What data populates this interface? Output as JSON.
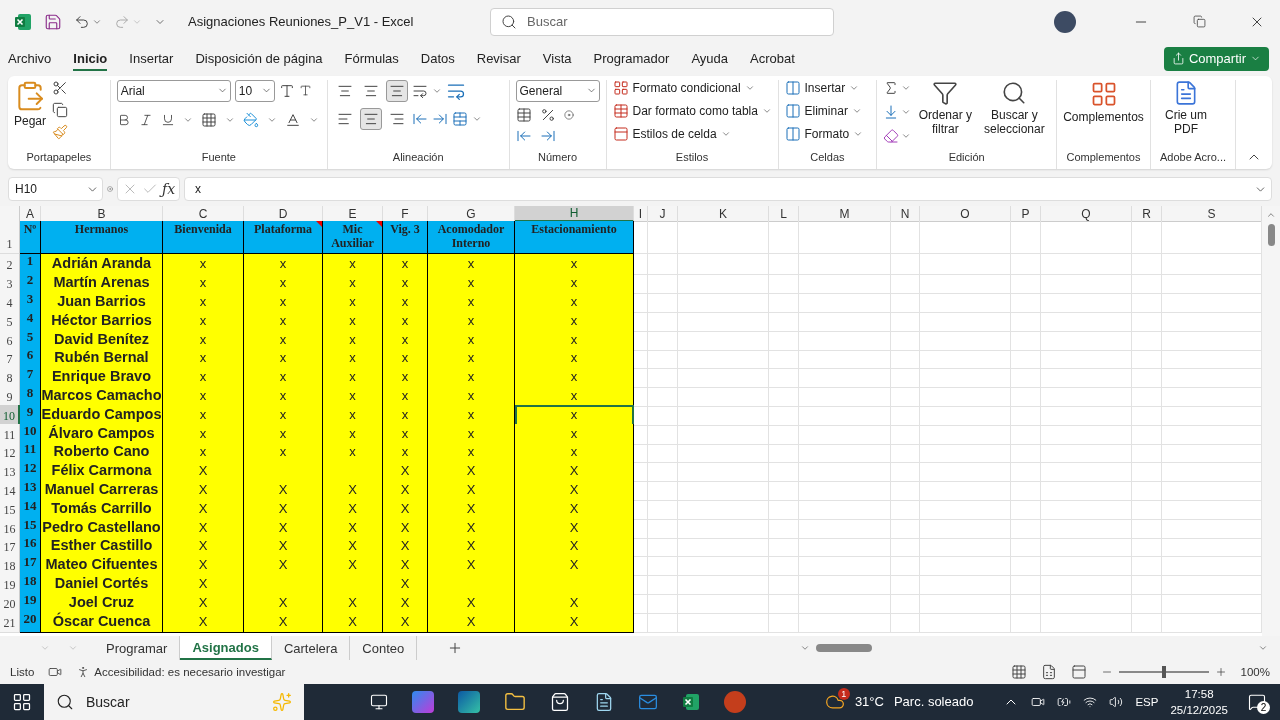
{
  "title_bar": {
    "title": "Asignaciones Reuniones_P_V1  -  Excel",
    "search": {
      "placeholder": "Buscar"
    }
  },
  "menu": {
    "tabs": [
      {
        "label": "Archivo",
        "selected": false
      },
      {
        "label": "Inicio",
        "selected": true
      },
      {
        "label": "Insertar",
        "selected": false
      },
      {
        "label": "Disposición de página",
        "selected": false
      },
      {
        "label": "Fórmulas",
        "selected": false
      },
      {
        "label": "Datos",
        "selected": false
      },
      {
        "label": "Revisar",
        "selected": false
      },
      {
        "label": "Vista",
        "selected": false
      },
      {
        "label": "Programador",
        "selected": false
      },
      {
        "label": "Ayuda",
        "selected": false
      },
      {
        "label": "Acrobat",
        "selected": false
      }
    ],
    "share": "Compartir"
  },
  "ribbon": {
    "clipboard": {
      "label": "Portapapeles",
      "paste": "Pegar"
    },
    "font": {
      "label": "Fuente",
      "font": "Arial",
      "size": "10"
    },
    "alignment": {
      "label": "Alineación",
      "vertical": [
        {
          "selected": false
        },
        {
          "selected": false
        },
        {
          "selected": true
        }
      ],
      "horizontal": [
        {
          "selected": false
        },
        {
          "selected": true
        },
        {
          "selected": false
        }
      ]
    },
    "number": {
      "label": "Número",
      "format": "General"
    },
    "styles": {
      "label": "Estilos",
      "items": [
        "Formato condicional",
        "Dar formato como tabla",
        "Estilos de celda"
      ]
    },
    "cells": {
      "label": "Celdas",
      "items": [
        "Insertar",
        "Eliminar",
        "Formato"
      ]
    },
    "editing": {
      "label": "Edición",
      "sort": "Ordenar y filtrar",
      "find": "Buscar y seleccionar"
    },
    "addins": {
      "label": "Complementos",
      "button": "Complementos"
    },
    "adobe": {
      "label": "Adobe Acro...",
      "button": "Crie um PDF"
    }
  },
  "formula_bar": {
    "name_box": "H10",
    "function_label": "ƒx",
    "value": "x"
  },
  "sheet": {
    "columns": [
      {
        "label": "A",
        "selected": false
      },
      {
        "label": "B",
        "selected": false
      },
      {
        "label": "C",
        "selected": false
      },
      {
        "label": "D",
        "selected": false
      },
      {
        "label": "E",
        "selected": false
      },
      {
        "label": "F",
        "selected": false
      },
      {
        "label": "G",
        "selected": false
      },
      {
        "label": "H",
        "selected": true
      },
      {
        "label": "I",
        "selected": false
      },
      {
        "label": "J",
        "selected": false
      },
      {
        "label": "K",
        "selected": false
      },
      {
        "label": "L",
        "selected": false
      },
      {
        "label": "M",
        "selected": false
      },
      {
        "label": "N",
        "selected": false
      },
      {
        "label": "O",
        "selected": false
      },
      {
        "label": "P",
        "selected": false
      },
      {
        "label": "Q",
        "selected": false
      },
      {
        "label": "R",
        "selected": false
      },
      {
        "label": "S",
        "selected": false
      }
    ],
    "header_row": {
      "row": "1",
      "cells": [
        "Nº",
        "Hermanos",
        "Bienvenida",
        "Plataforma",
        "Mic Auxiliar",
        "Vig. 3",
        "Acomodador Interno",
        "Estacionamiento"
      ]
    },
    "rows": [
      {
        "row": "2",
        "selected": false,
        "num": "1",
        "name": "Adrián Aranda",
        "marks": [
          "x",
          "x",
          "x",
          "x",
          "x",
          "x"
        ]
      },
      {
        "row": "3",
        "selected": false,
        "num": "2",
        "name": "Martín Arenas",
        "marks": [
          "x",
          "x",
          "x",
          "x",
          "x",
          "x"
        ]
      },
      {
        "row": "4",
        "selected": false,
        "num": "3",
        "name": "Juan Barrios",
        "marks": [
          "x",
          "x",
          "x",
          "x",
          "x",
          "x"
        ]
      },
      {
        "row": "5",
        "selected": false,
        "num": "4",
        "name": "Héctor Barrios",
        "marks": [
          "x",
          "x",
          "x",
          "x",
          "x",
          "x"
        ]
      },
      {
        "row": "6",
        "selected": false,
        "num": "5",
        "name": "David Benítez",
        "marks": [
          "x",
          "x",
          "x",
          "x",
          "x",
          "x"
        ]
      },
      {
        "row": "7",
        "selected": false,
        "num": "6",
        "name": "Rubén Bernal",
        "marks": [
          "x",
          "x",
          "x",
          "x",
          "x",
          "x"
        ]
      },
      {
        "row": "8",
        "selected": false,
        "num": "7",
        "name": "Enrique Bravo",
        "marks": [
          "x",
          "x",
          "x",
          "x",
          "x",
          "x"
        ]
      },
      {
        "row": "9",
        "selected": false,
        "num": "8",
        "name": "Marcos Camacho",
        "marks": [
          "x",
          "x",
          "x",
          "x",
          "x",
          "x"
        ]
      },
      {
        "row": "10",
        "selected": true,
        "num": "9",
        "name": "Eduardo Campos",
        "marks": [
          "x",
          "x",
          "x",
          "x",
          "x",
          "x"
        ]
      },
      {
        "row": "11",
        "selected": false,
        "num": "10",
        "name": "Álvaro Campos",
        "marks": [
          "x",
          "x",
          "x",
          "x",
          "x",
          "x"
        ]
      },
      {
        "row": "12",
        "selected": false,
        "num": "11",
        "name": "Roberto Cano",
        "marks": [
          "x",
          "x",
          "x",
          "x",
          "x",
          "x"
        ]
      },
      {
        "row": "13",
        "selected": false,
        "num": "12",
        "name": "Félix Carmona",
        "marks": [
          "X",
          {
            "kind": "empty"
          },
          {
            "kind": "empty"
          },
          "X",
          "X",
          "X"
        ]
      },
      {
        "row": "14",
        "selected": false,
        "num": "13",
        "name": "Manuel Carreras",
        "marks": [
          "X",
          "X",
          "X",
          "X",
          "X",
          "X"
        ]
      },
      {
        "row": "15",
        "selected": false,
        "num": "14",
        "name": "Tomás Carrillo",
        "marks": [
          "X",
          "X",
          "X",
          "X",
          "X",
          "X"
        ]
      },
      {
        "row": "16",
        "selected": false,
        "num": "15",
        "name": "Pedro Castellano",
        "marks": [
          "X",
          "X",
          "X",
          "X",
          "X",
          "X"
        ]
      },
      {
        "row": "17",
        "selected": false,
        "num": "16",
        "name": "Esther Castillo",
        "marks": [
          "X",
          "X",
          "X",
          "X",
          "X",
          "X"
        ]
      },
      {
        "row": "18",
        "selected": false,
        "num": "17",
        "name": "Mateo Cifuentes",
        "marks": [
          "X",
          "X",
          "X",
          "X",
          "X",
          "X"
        ]
      },
      {
        "row": "19",
        "selected": false,
        "num": "18",
        "name": "Daniel Cortés",
        "marks": [
          "X",
          {
            "kind": "empty"
          },
          {
            "kind": "empty"
          },
          "X",
          {
            "kind": "empty"
          },
          {
            "kind": "empty"
          }
        ]
      },
      {
        "row": "20",
        "selected": false,
        "num": "19",
        "name": "Joel Cruz",
        "marks": [
          "X",
          "X",
          "X",
          "X",
          "X",
          "X"
        ]
      },
      {
        "row": "21",
        "selected": false,
        "num": "20",
        "name": "Óscar Cuenca",
        "marks": [
          "X",
          "X",
          "X",
          "X",
          "X",
          "X"
        ]
      }
    ]
  },
  "sheet_tabs": [
    {
      "label": "Programar",
      "selected": false
    },
    {
      "label": "Asignados",
      "selected": true
    },
    {
      "label": "Cartelera",
      "selected": false
    },
    {
      "label": "Conteo",
      "selected": false
    }
  ],
  "status_bar": {
    "status": "Listo",
    "accessibility": "Accesibilidad: es necesario investigar",
    "zoom": {
      "level": 0.5,
      "reading": "100%"
    }
  },
  "taskbar": {
    "search": {
      "placeholder": "Buscar"
    },
    "weather": {
      "badge": "1",
      "temperature": "31°C",
      "condition": "Parc. soleado"
    },
    "language": "ESP",
    "time": "17:58",
    "date": "25/12/2025",
    "notifications": "2"
  }
}
